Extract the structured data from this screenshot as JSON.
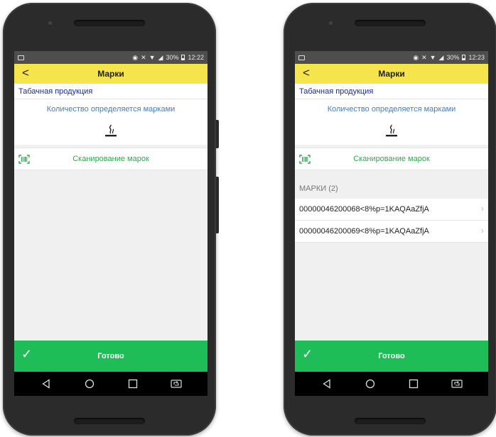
{
  "screens": [
    {
      "status": {
        "battery": "30%",
        "time": "12:22"
      },
      "appbar": {
        "back_glyph": "<",
        "title": "Марки"
      },
      "section_title": "Табачная продукция",
      "quantity_text": "Количество определяется марками",
      "scan_label": "Сканирование марок",
      "done_label": "Готово"
    },
    {
      "status": {
        "battery": "30%",
        "time": "12:23"
      },
      "appbar": {
        "back_glyph": "<",
        "title": "Марки"
      },
      "section_title": "Табачная продукция",
      "quantity_text": "Количество определяется марками",
      "scan_label": "Сканирование марок",
      "marks_header": "МАРКИ (2)",
      "marks": [
        "00000046200068<8%p=1KAQAaZfjA",
        "00000046200069<8%p=1KAQAaZfjA"
      ],
      "done_label": "Готово"
    }
  ],
  "colors": {
    "appbar": "#f5e44b",
    "done_bar": "#1fbd57",
    "scan_green": "#2fa84f",
    "section_title": "#1a2c8a",
    "quantity_text": "#4a7bb5"
  },
  "icons": {
    "back": "chevron-left-icon",
    "smoke": "cigarette-smoke-icon",
    "barcode": "barcode-scan-icon",
    "done": "check-icon",
    "nav": [
      "back-triangle-icon",
      "home-circle-icon",
      "recents-square-icon",
      "screen-rotate-icon"
    ]
  }
}
